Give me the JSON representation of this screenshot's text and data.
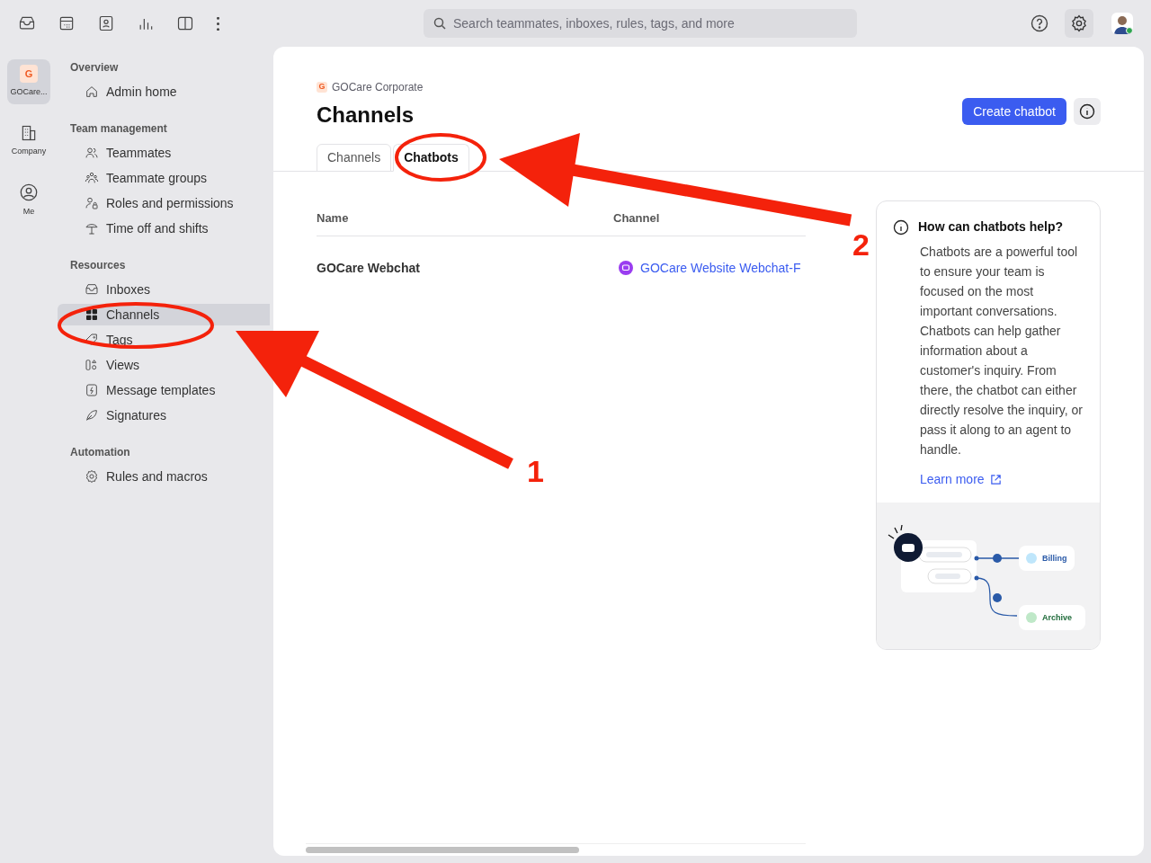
{
  "topbar": {
    "search": {
      "placeholder": "Search teammates, inboxes, rules, tags, and more"
    }
  },
  "rail": [
    {
      "label": "GOCare...",
      "kind": "workspace",
      "badge": "G",
      "selected": true
    },
    {
      "label": "Company",
      "kind": "company",
      "selected": false
    },
    {
      "label": "Me",
      "kind": "me",
      "selected": false
    }
  ],
  "nav": [
    {
      "heading": "Overview",
      "items": [
        {
          "label": "Admin home",
          "kind": "home",
          "selected": false
        }
      ]
    },
    {
      "heading": "Team management",
      "items": [
        {
          "label": "Teammates",
          "kind": "people",
          "selected": false
        },
        {
          "label": "Teammate groups",
          "kind": "groups",
          "selected": false
        },
        {
          "label": "Roles and permissions",
          "kind": "roles",
          "selected": false
        },
        {
          "label": "Time off and shifts",
          "kind": "timeoff",
          "selected": false
        }
      ]
    },
    {
      "heading": "Resources",
      "items": [
        {
          "label": "Inboxes",
          "kind": "inbox",
          "selected": false
        },
        {
          "label": "Channels",
          "kind": "grid",
          "selected": true
        },
        {
          "label": "Tags",
          "kind": "tag",
          "selected": false
        },
        {
          "label": "Views",
          "kind": "views",
          "selected": false
        },
        {
          "label": "Message templates",
          "kind": "template",
          "selected": false
        },
        {
          "label": "Signatures",
          "kind": "leaf",
          "selected": false
        }
      ]
    },
    {
      "heading": "Automation",
      "items": [
        {
          "label": "Rules and macros",
          "kind": "gear",
          "selected": false
        }
      ]
    }
  ],
  "page": {
    "workspace_badge": "G",
    "workspace": "GOCare Corporate",
    "title": "Channels",
    "primary_button": "Create chatbot",
    "tabs": [
      {
        "label": "Channels",
        "selected": false
      },
      {
        "label": "Chatbots",
        "selected": true
      }
    ],
    "table": {
      "columns": [
        "Name",
        "Channel"
      ],
      "rows": [
        {
          "name": "GOCare Webchat",
          "channel": "GOCare Website Webchat-F"
        }
      ]
    }
  },
  "help_card": {
    "title": "How can chatbots help?",
    "body": "Chatbots are a powerful tool to ensure your team is focused on the most important conversations. Chatbots can help gather information about a customer's inquiry. From there, the chatbot can either directly resolve the inquiry, or pass it along to an agent to handle.",
    "link": "Learn more",
    "diagram_labels": [
      "Billing",
      "Archive"
    ]
  },
  "annotations": [
    {
      "number": "1"
    },
    {
      "number": "2"
    }
  ]
}
